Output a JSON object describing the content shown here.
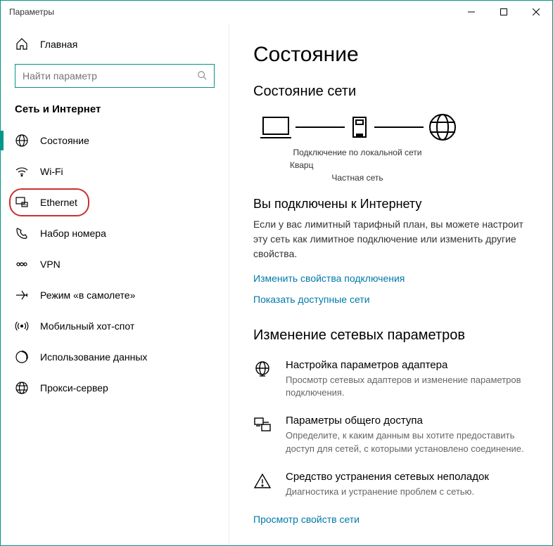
{
  "window": {
    "title": "Параметры"
  },
  "home": {
    "label": "Главная"
  },
  "search": {
    "placeholder": "Найти параметр"
  },
  "section": {
    "title": "Сеть и Интернет"
  },
  "nav": {
    "items": [
      {
        "label": "Состояние"
      },
      {
        "label": "Wi-Fi"
      },
      {
        "label": "Ethernet"
      },
      {
        "label": "Набор номера"
      },
      {
        "label": "VPN"
      },
      {
        "label": "Режим «в самолете»"
      },
      {
        "label": "Мобильный хот-спот"
      },
      {
        "label": "Использование данных"
      },
      {
        "label": "Прокси-сервер"
      }
    ]
  },
  "main": {
    "title": "Состояние",
    "netstate_title": "Состояние сети",
    "diag": {
      "line1": "Подключение по локальной сети",
      "line2": "Кварц",
      "line3": "Частная сеть"
    },
    "connected_heading": "Вы подключены к Интернету",
    "connected_body": "Если у вас лимитный тарифный план, вы можете настроит эту сеть как лимитное подключение или изменить другие свойства.",
    "link_change_props": "Изменить свойства подключения",
    "link_show_nets": "Показать доступные сети",
    "change_params_title": "Изменение сетевых параметров",
    "opt1": {
      "title": "Настройка параметров адаптера",
      "desc": "Просмотр сетевых адаптеров и изменение параметров подключения."
    },
    "opt2": {
      "title": "Параметры общего доступа",
      "desc": "Определите, к каким данным вы хотите предоставить доступ для сетей, с которыми установлено соединение."
    },
    "opt3": {
      "title": "Средство устранения сетевых неполадок",
      "desc": "Диагностика и устранение проблем с сетью."
    },
    "link_view_props": "Просмотр свойств сети"
  }
}
